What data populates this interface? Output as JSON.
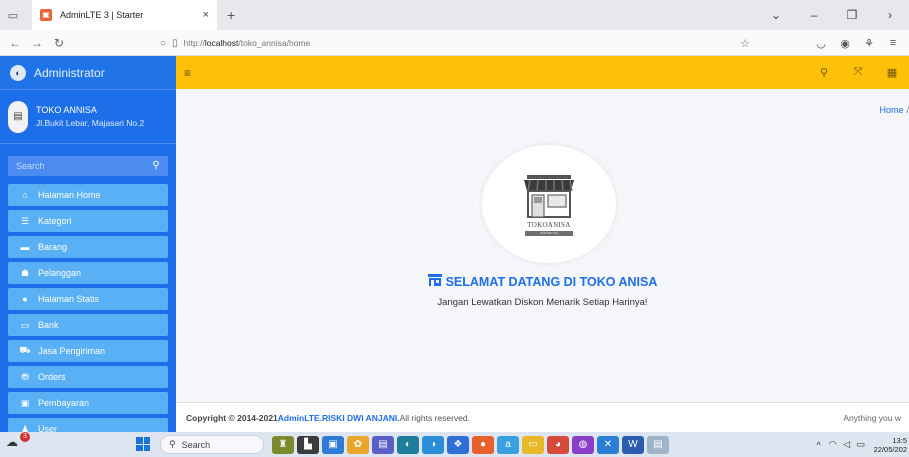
{
  "browser": {
    "tab_title": "AdminLTE 3 | Starter",
    "tab_close": "×",
    "new_tab": "+",
    "url_prefix": "http://",
    "url_host": "localhost",
    "url_path": "/toko_annisa/home"
  },
  "sidebar": {
    "brand": "Administrator",
    "user_name": "TOKO ANNISA",
    "user_address": "Jl.Bukit Lebar, Majasari No.2",
    "search_placeholder": "Search",
    "items": [
      {
        "label": "Halaman Home",
        "icon": "home-icon"
      },
      {
        "label": "Kategori",
        "icon": "list-icon"
      },
      {
        "label": "Barang",
        "icon": "box-icon"
      },
      {
        "label": "Pelanggan",
        "icon": "users-icon"
      },
      {
        "label": "Halaman Statis",
        "icon": "info-icon"
      },
      {
        "label": "Bank",
        "icon": "bank-icon"
      },
      {
        "label": "Jasa Pengiriman",
        "icon": "truck-icon"
      },
      {
        "label": "Orders",
        "icon": "cart-icon"
      },
      {
        "label": "Pembayaran",
        "icon": "payment-icon"
      },
      {
        "label": "User",
        "icon": "user-icon"
      }
    ]
  },
  "breadcrumb": {
    "home": "Home",
    "sep": "/"
  },
  "logo": {
    "text": "TOKOANISA",
    "sub": "PERABOTAN"
  },
  "main": {
    "welcome": "SELAMAT DATANG DI TOKO ANISA",
    "tagline": "Jangan Lewatkan Diskon Menarik Setiap Harinya!"
  },
  "footer": {
    "copyright": "Copyright © 2014-2021 ",
    "link": "AdminLTE.RISKI DWI ANJANI.",
    "rights": " All rights reserved.",
    "right_text": "Anything you w"
  },
  "taskbar": {
    "search": "Search",
    "badge": "3",
    "time": "13:5",
    "date": "22/05/202"
  },
  "colors": {
    "sidebar": "#1c6fe8",
    "menu_item": "#5ab0f5",
    "navbar": "#ffc107",
    "accent": "#1c6fe8"
  }
}
